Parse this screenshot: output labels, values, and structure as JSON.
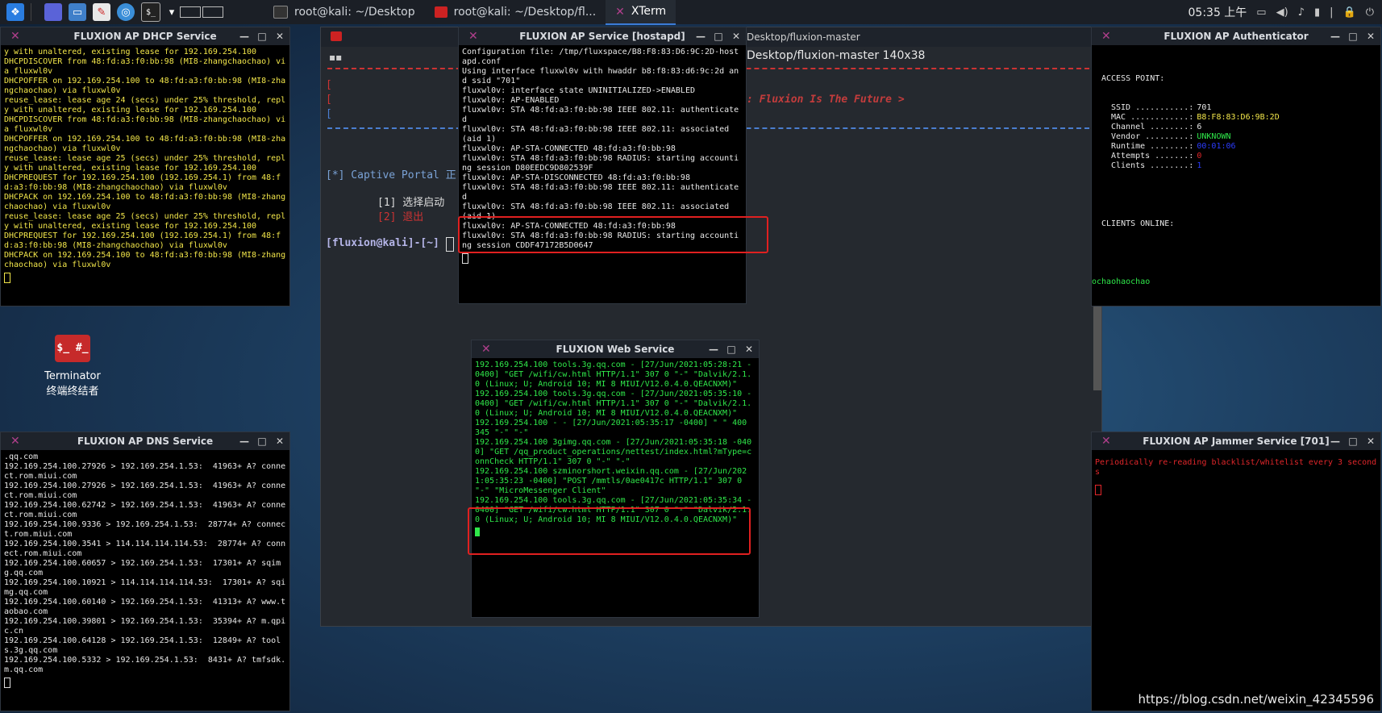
{
  "taskbar": {
    "tasks": [
      {
        "label": "root@kali: ~/Desktop"
      },
      {
        "label": "root@kali: ~/Desktop/fl..."
      },
      {
        "label": "XTerm"
      }
    ],
    "clock": "05:35 上午"
  },
  "bg_terminal": {
    "title_fragment": "Desktop/fluxion-master",
    "subtitle": "Desktop/fluxion-master 140x38",
    "banner": ": Fluxion Is The Future >",
    "captive": "[*] Captive Portal 正",
    "option1": "[1] 选择启动",
    "option2": "[2] 退出",
    "prompt": "[fluxion@kali]-[~]"
  },
  "desktop_icon": {
    "glyph": "$_ #_",
    "label1": "Terminator",
    "label2": "终端终结者"
  },
  "dhcp": {
    "title": "FLUXION AP DHCP Service",
    "text": "y with unaltered, existing lease for 192.169.254.100\nDHCPDISCOVER from 48:fd:a3:f0:bb:98 (MI8-zhangchaochao) via fluxwl0v\nDHCPOFFER on 192.169.254.100 to 48:fd:a3:f0:bb:98 (MI8-zhangchaochao) via fluxwl0v\nreuse_lease: lease age 24 (secs) under 25% threshold, reply with unaltered, existing lease for 192.169.254.100\nDHCPDISCOVER from 48:fd:a3:f0:bb:98 (MI8-zhangchaochao) via fluxwl0v\nDHCPOFFER on 192.169.254.100 to 48:fd:a3:f0:bb:98 (MI8-zhangchaochao) via fluxwl0v\nreuse_lease: lease age 25 (secs) under 25% threshold, reply with unaltered, existing lease for 192.169.254.100\nDHCPREQUEST for 192.169.254.100 (192.169.254.1) from 48:fd:a3:f0:bb:98 (MI8-zhangchaochao) via fluxwl0v\nDHCPACK on 192.169.254.100 to 48:fd:a3:f0:bb:98 (MI8-zhangchaochao) via fluxwl0v\nreuse_lease: lease age 25 (secs) under 25% threshold, reply with unaltered, existing lease for 192.169.254.100\nDHCPREQUEST for 192.169.254.100 (192.169.254.1) from 48:fd:a3:f0:bb:98 (MI8-zhangchaochao) via fluxwl0v\nDHCPACK on 192.169.254.100 to 48:fd:a3:f0:bb:98 (MI8-zhangchaochao) via fluxwl0v"
  },
  "hostapd": {
    "title": "FLUXION AP Service [hostapd]",
    "text": "Configuration file: /tmp/fluxspace/B8:F8:83:D6:9C:2D-hostapd.conf\nUsing interface fluxwl0v with hwaddr b8:f8:83:d6:9c:2d and ssid \"701\"\nfluxwl0v: interface state UNINITIALIZED->ENABLED\nfluxwl0v: AP-ENABLED\nfluxwl0v: STA 48:fd:a3:f0:bb:98 IEEE 802.11: authenticated\nfluxwl0v: STA 48:fd:a3:f0:bb:98 IEEE 802.11: associated (aid 1)\nfluxwl0v: AP-STA-CONNECTED 48:fd:a3:f0:bb:98\nfluxwl0v: STA 48:fd:a3:f0:bb:98 RADIUS: starting accounting session D80EEDC9D802539F\nfluxwl0v: AP-STA-DISCONNECTED 48:fd:a3:f0:bb:98\nfluxwl0v: STA 48:fd:a3:f0:bb:98 IEEE 802.11: authenticated\nfluxwl0v: STA 48:fd:a3:f0:bb:98 IEEE 802.11: associated (aid 1)\nfluxwl0v: AP-STA-CONNECTED 48:fd:a3:f0:bb:98\nfluxwl0v: STA 48:fd:a3:f0:bb:98 RADIUS: starting accounting session CDDF47172B5D0647"
  },
  "auth": {
    "title": "FLUXION AP Authenticator",
    "heading": "ACCESS POINT:",
    "rows": [
      {
        "label": "SSID ...........:",
        "value": "701",
        "color": "#e8e8e8"
      },
      {
        "label": "MAC ............:",
        "value": "B8:F8:83:D6:9B:2D",
        "color": "#f2e64a"
      },
      {
        "label": "Channel ........:",
        "value": "6",
        "color": "#e8e8e8"
      },
      {
        "label": "Vendor .........:",
        "value": "UNKNOWN",
        "color": "#2fe84a"
      },
      {
        "label": "Runtime ........:",
        "value": "00:01:06",
        "color": "#2b3cff"
      },
      {
        "label": "Attempts .......:",
        "value": "0",
        "color": "#e0262a"
      },
      {
        "label": "Clients ........:",
        "value": "1",
        "color": "#2b3cff"
      }
    ],
    "clients_heading": "CLIENTS ONLINE:",
    "client": "ochaohaochao"
  },
  "web": {
    "title": "FLUXION Web Service",
    "text": "192.169.254.100 tools.3g.qq.com - [27/Jun/2021:05:28:21 -0400] \"GET /wifi/cw.html HTTP/1.1\" 307 0 \"-\" \"Dalvik/2.1.0 (Linux; U; Android 10; MI 8 MIUI/V12.0.4.0.QEACNXM)\"\n192.169.254.100 tools.3g.qq.com - [27/Jun/2021:05:35:10 -0400] \"GET /wifi/cw.html HTTP/1.1\" 307 0 \"-\" \"Dalvik/2.1.0 (Linux; U; Android 10; MI 8 MIUI/V12.0.4.0.QEACNXM)\"\n192.169.254.100 - - [27/Jun/2021:05:35:17 -0400] \" \" 400 345 \"-\" \"-\"\n192.169.254.100 3gimg.qq.com - [27/Jun/2021:05:35:18 -0400] \"GET /qq_product_operations/nettest/index.html?mType=connCheck HTTP/1.1\" 307 0 \"-\" \"-\"\n192.169.254.100 szminorshort.weixin.qq.com - [27/Jun/2021:05:35:23 -0400] \"POST /mmtls/0ae0417c HTTP/1.1\" 307 0 \"-\" \"MicroMessenger Client\"\n192.169.254.100 tools.3g.qq.com - [27/Jun/2021:05:35:34 -0400] \"GET /wifi/cw.html HTTP/1.1\" 307 0 \"-\" \"Dalvik/2.1.0 (Linux; U; Android 10; MI 8 MIUI/V12.0.4.0.QEACNXM)\""
  },
  "dns": {
    "title": "FLUXION AP DNS Service",
    "text": ".qq.com\n192.169.254.100.27926 > 192.169.254.1.53:  41963+ A? connect.rom.miui.com\n192.169.254.100.27926 > 192.169.254.1.53:  41963+ A? connect.rom.miui.com\n192.169.254.100.62742 > 192.169.254.1.53:  41963+ A? connect.rom.miui.com\n192.169.254.100.9336 > 192.169.254.1.53:  28774+ A? connect.rom.miui.com\n192.169.254.100.3541 > 114.114.114.114.53:  28774+ A? connect.rom.miui.com\n192.169.254.100.60657 > 192.169.254.1.53:  17301+ A? sqimg.qq.com\n192.169.254.100.10921 > 114.114.114.114.53:  17301+ A? sqimg.qq.com\n192.169.254.100.60140 > 192.169.254.1.53:  41313+ A? www.taobao.com\n192.169.254.100.39801 > 192.169.254.1.53:  35394+ A? m.qpic.cn\n192.169.254.100.64128 > 192.169.254.1.53:  12849+ A? tools.3g.qq.com\n192.169.254.100.5332 > 192.169.254.1.53:  8431+ A? tmfsdk.m.qq.com"
  },
  "jammer": {
    "title": "FLUXION AP Jammer Service [701]",
    "text": "Periodically re-reading blacklist/whitelist every 3 seconds"
  },
  "watermark": "https://blog.csdn.net/weixin_42345596"
}
